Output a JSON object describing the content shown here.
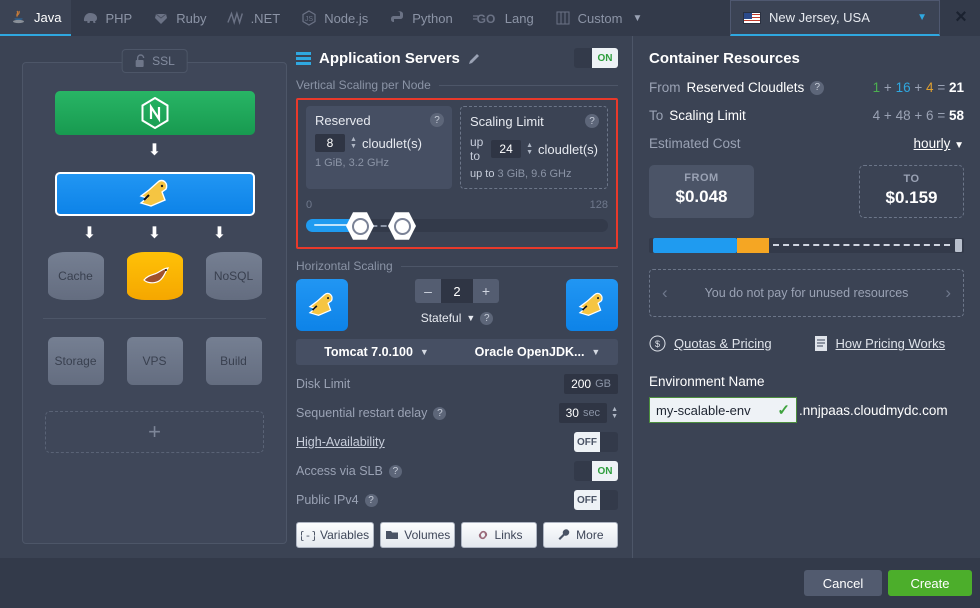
{
  "topbar": {
    "tabs": [
      {
        "label": "Java",
        "icon": "java-icon",
        "active": true
      },
      {
        "label": "PHP",
        "icon": "php-elephant-icon",
        "active": false
      },
      {
        "label": "Ruby",
        "icon": "ruby-gem-icon",
        "active": false
      },
      {
        "label": ".NET",
        "icon": "dotnet-icon",
        "active": false
      },
      {
        "label": "Node.js",
        "icon": "nodejs-icon",
        "active": false
      },
      {
        "label": "Python",
        "icon": "python-icon",
        "active": false
      },
      {
        "label": "Lang",
        "icon": "go-lang-icon",
        "active": false
      },
      {
        "label": "Custom",
        "icon": "custom-stack-icon",
        "active": false
      }
    ],
    "region": "New Jersey, USA",
    "close_label": "×"
  },
  "topology": {
    "ssl_label": "SSL",
    "nodes": [
      {
        "name": "nginx-balancer",
        "label": "",
        "icon": "nginx-icon"
      },
      {
        "name": "tomcat-server",
        "label": "",
        "icon": "tomcat-icon"
      }
    ],
    "db_row": [
      {
        "label": "Cache",
        "icon": "cache-icon"
      },
      {
        "label": "",
        "icon": "mariadb-icon"
      },
      {
        "label": "NoSQL",
        "icon": "nosql-icon"
      }
    ],
    "extras": [
      {
        "label": "Storage",
        "icon": "storage-icon"
      },
      {
        "label": "VPS",
        "icon": "vps-icon"
      },
      {
        "label": "Build",
        "icon": "build-icon"
      }
    ],
    "add_label": "+"
  },
  "middle": {
    "title": "Application Servers",
    "power_toggle": "ON",
    "vertical_section_label": "Vertical Scaling per Node",
    "reserved": {
      "title": "Reserved",
      "value": "8",
      "unit": "cloudlet(s)",
      "detail": "1 GiB, 3.2 GHz",
      "help": "?"
    },
    "scaling_limit": {
      "title": "Scaling Limit",
      "prefix": "up to",
      "value": "24",
      "unit": "cloudlet(s)",
      "detail_prefix": "up to",
      "detail": "3 GiB, 9.6 GHz",
      "help": "?"
    },
    "slider": {
      "min": "0",
      "max": "128"
    },
    "horizontal_section_label": "Horizontal Scaling",
    "node_count": "2",
    "minus": "–",
    "plus": "+",
    "stateful": "Stateful",
    "stateful_help": "?",
    "engine": "Tomcat 7.0.100",
    "jdk": "Oracle OpenJDK...",
    "disk_limit": {
      "label": "Disk Limit",
      "value": "200",
      "unit": "GB"
    },
    "restart_delay": {
      "label": "Sequential restart delay",
      "help": "?",
      "value": "30",
      "unit": "sec"
    },
    "high_availability": {
      "label": "High-Availability",
      "state": "OFF"
    },
    "access_slb": {
      "label": "Access via SLB",
      "help": "?",
      "state": "ON"
    },
    "public_ipv4": {
      "label": "Public IPv4",
      "help": "?",
      "state": "OFF"
    },
    "buttons": [
      {
        "label": "Variables",
        "icon": "variables-icon"
      },
      {
        "label": "Volumes",
        "icon": "volumes-icon"
      },
      {
        "label": "Links",
        "icon": "links-icon"
      },
      {
        "label": "More",
        "icon": "wrench-icon"
      }
    ]
  },
  "right": {
    "title": "Container Resources",
    "from_reserved": {
      "label_prefix": "From ",
      "label_bold": "Reserved Cloudlets",
      "help": "?",
      "a": "1",
      "b": "16",
      "c": "4",
      "total": "21",
      "plus": "+",
      "eq": "="
    },
    "to_limit": {
      "label_prefix": "To ",
      "label_bold": "Scaling Limit",
      "a": "4",
      "b": "48",
      "c": "6",
      "total": "58",
      "plus": "+",
      "eq": "="
    },
    "estimated_cost_label": "Estimated Cost",
    "period": "hourly",
    "price_from": {
      "caption": "FROM",
      "amount": "$0.048"
    },
    "price_to": {
      "caption": "TO",
      "amount": "$0.159"
    },
    "promo": "You do not pay for unused resources",
    "prev": "‹",
    "next": "›",
    "quotas_link": "Quotas & Pricing",
    "pricing_link": "How Pricing Works",
    "env_label": "Environment Name",
    "env_value": "my-scalable-env",
    "env_suffix": ".nnjpaas.cloudmydc.com",
    "env_valid_mark": "✓"
  },
  "footer": {
    "cancel": "Cancel",
    "create": "Create"
  },
  "colors": {
    "accent_blue": "#2fa8e0",
    "create_green": "#4cae2b",
    "highlight_red": "#e8392b",
    "orange": "#f5a623",
    "nginx_green": "#28b565"
  }
}
